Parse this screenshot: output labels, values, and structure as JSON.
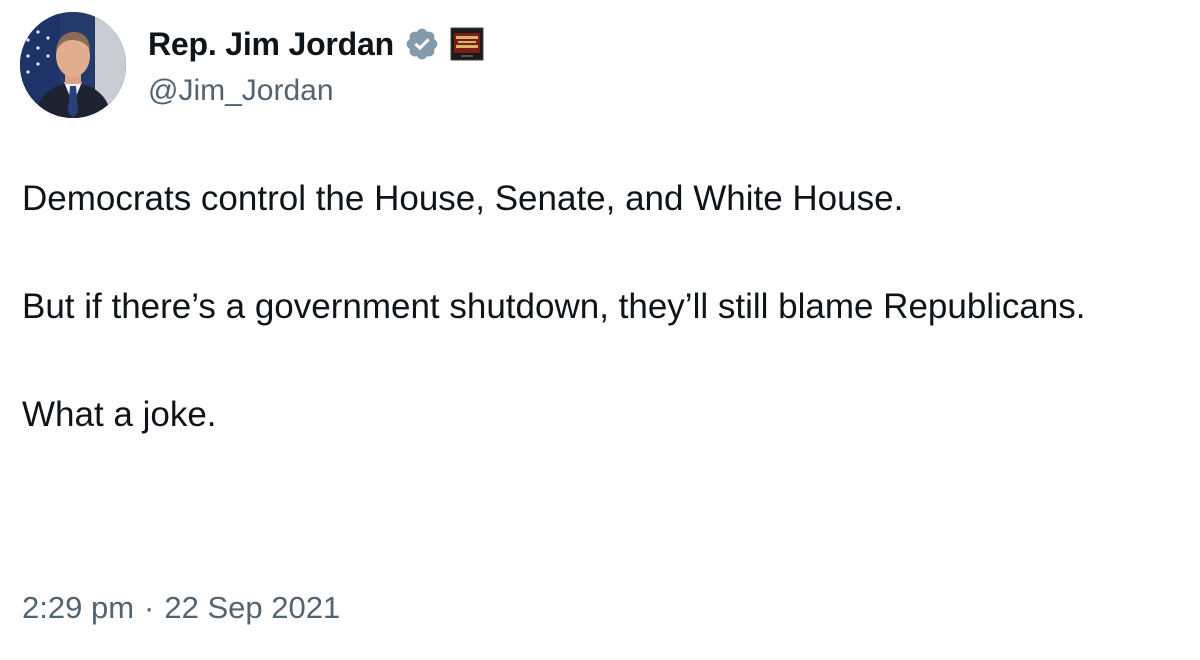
{
  "tweet": {
    "author": {
      "display_name": "Rep. Jim Jordan",
      "handle": "@Jim_Jordan",
      "avatar_icon": "profile-photo",
      "verified_icon": "verified-badge-icon",
      "affiliate_icon": "affiliation-badge-icon"
    },
    "text": {
      "paragraph_1": "Democrats control the House, Senate, and White House.",
      "paragraph_2": "But if there’s a government shutdown, they’ll still blame Republicans.",
      "paragraph_3": "What a joke."
    },
    "meta": {
      "time": "2:29 pm",
      "separator": "·",
      "date": "22 Sep 2021"
    }
  },
  "colors": {
    "text_primary": "#0f1419",
    "text_secondary": "#536471",
    "verified_badge": "#829aab",
    "background": "#ffffff"
  }
}
